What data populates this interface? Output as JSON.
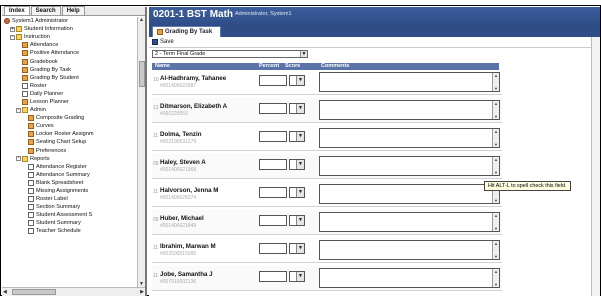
{
  "nav": {
    "tabs": [
      "Index",
      "Search",
      "Help"
    ]
  },
  "tree": [
    {
      "label": "System1 Administrator",
      "icon": "person",
      "indent": 0,
      "exp": ""
    },
    {
      "label": "Student Information",
      "icon": "folder",
      "indent": 1,
      "exp": "+"
    },
    {
      "label": "Instruction",
      "icon": "folder",
      "indent": 1,
      "exp": "-"
    },
    {
      "label": "Attendance",
      "icon": "tool",
      "indent": 3,
      "exp": ""
    },
    {
      "label": "Positive Attendance",
      "icon": "tool",
      "indent": 3,
      "exp": ""
    },
    {
      "label": "Gradebook",
      "icon": "tool",
      "indent": 3,
      "exp": ""
    },
    {
      "label": "Grading By Task",
      "icon": "tool",
      "indent": 3,
      "exp": ""
    },
    {
      "label": "Grading By Student",
      "icon": "tool",
      "indent": 3,
      "exp": ""
    },
    {
      "label": "Roster",
      "icon": "page",
      "indent": 3,
      "exp": ""
    },
    {
      "label": "Daily Planner",
      "icon": "page",
      "indent": 3,
      "exp": ""
    },
    {
      "label": "Lesson Planner",
      "icon": "tool",
      "indent": 3,
      "exp": ""
    },
    {
      "label": "Admin",
      "icon": "folder",
      "indent": 2,
      "exp": "-"
    },
    {
      "label": "Composite Grading",
      "icon": "tool",
      "indent": 4,
      "exp": ""
    },
    {
      "label": "Curves",
      "icon": "tool",
      "indent": 4,
      "exp": ""
    },
    {
      "label": "Locker Roster Assignm",
      "icon": "tool",
      "indent": 4,
      "exp": ""
    },
    {
      "label": "Seating Chart Setup",
      "icon": "tool",
      "indent": 4,
      "exp": ""
    },
    {
      "label": "Preferences",
      "icon": "tool",
      "indent": 4,
      "exp": ""
    },
    {
      "label": "Reports",
      "icon": "folder",
      "indent": 2,
      "exp": "-"
    },
    {
      "label": "Attendance Register",
      "icon": "page",
      "indent": 4,
      "exp": ""
    },
    {
      "label": "Attendance Summary",
      "icon": "page",
      "indent": 4,
      "exp": ""
    },
    {
      "label": "Blank Spreadsheet",
      "icon": "page",
      "indent": 4,
      "exp": ""
    },
    {
      "label": "Missing Assignments",
      "icon": "page",
      "indent": 4,
      "exp": ""
    },
    {
      "label": "Roster Label",
      "icon": "page",
      "indent": 4,
      "exp": ""
    },
    {
      "label": "Section Summary",
      "icon": "page",
      "indent": 4,
      "exp": ""
    },
    {
      "label": "Student Assessment S",
      "icon": "page",
      "indent": 4,
      "exp": ""
    },
    {
      "label": "Student Summary",
      "icon": "page",
      "indent": 4,
      "exp": ""
    },
    {
      "label": "Teacher Schedule",
      "icon": "page",
      "indent": 4,
      "exp": ""
    }
  ],
  "header": {
    "course": "0201-1 BST Math",
    "user": "Administrator, System1"
  },
  "subtab": {
    "label": "Grading By Task",
    "icon": "grading-icon"
  },
  "toolbar": {
    "save_label": "Save"
  },
  "term_select": {
    "value": "2 - Term Final Grade"
  },
  "grid": {
    "columns": {
      "name": "Name",
      "percent": "Percent",
      "score": "Score",
      "comments": "Comments"
    },
    "students": [
      {
        "num": "10",
        "name": "Al-Hadhramy, Tahanee",
        "id": "#001400622987"
      },
      {
        "num": "12",
        "name": "Ditmarson, Elizabeth A",
        "id": "#060220053"
      },
      {
        "num": "11",
        "name": "Dolma, Tenzin",
        "id": "#002100631279"
      },
      {
        "num": "09",
        "name": "Haley, Steven A",
        "id": "#001400621968"
      },
      {
        "num": "11",
        "name": "Halvorson, Jenna M",
        "id": "#001400628374"
      },
      {
        "num": "09",
        "name": "Huber, Michael",
        "id": "#001400621849"
      },
      {
        "num": "11",
        "name": "Ibrahim, Marwan M",
        "id": "#002500515095"
      },
      {
        "num": "11",
        "name": "Jobe, Samantha J",
        "id": "#007910002136"
      }
    ]
  },
  "tooltip": {
    "text": "Hit ALT-L to spell check this field."
  }
}
